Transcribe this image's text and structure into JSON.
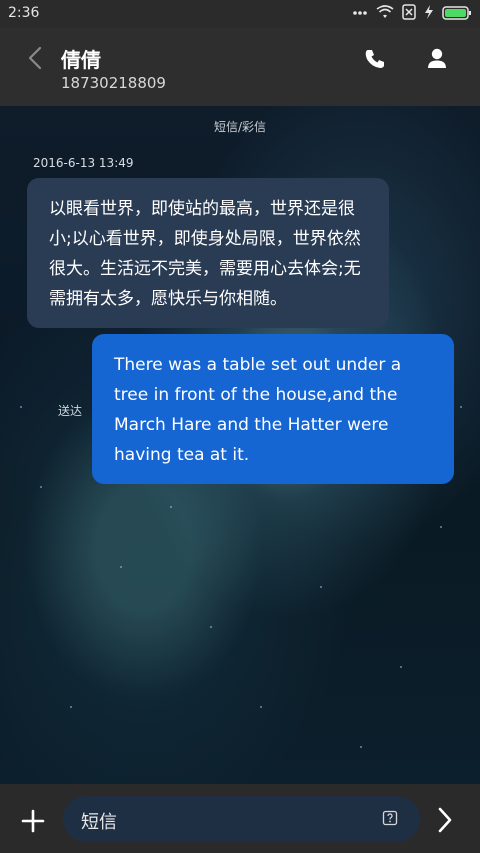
{
  "status_bar": {
    "time": "2:36",
    "icons": [
      "more-dots-icon",
      "wifi-icon",
      "sim-x-icon",
      "charging-icon",
      "battery-icon"
    ]
  },
  "header": {
    "contact_name": "倩倩",
    "contact_number": "18730218809",
    "actions": [
      "phone-icon",
      "person-icon"
    ]
  },
  "conversation": {
    "mode_label": "短信/彩信",
    "timestamp": "2016-6-13 13:49",
    "incoming_message": "以眼看世界，即使站的最高，世界还是很小;以心看世界，即使身处局限，世界依然很大。生活远不完美，需要用心去体会;无需拥有太多，愿快乐与你相随。",
    "outgoing_message": "There was a table set out under a tree in front of the house,and the March Hare and the Hatter were having tea at it.",
    "sent_label": "送达"
  },
  "input_bar": {
    "placeholder_text": "短信"
  },
  "colors": {
    "incoming_bubble": "#2a3b54",
    "outgoing_bubble": "#1565d2",
    "header_bg": "#2e2e2e"
  }
}
